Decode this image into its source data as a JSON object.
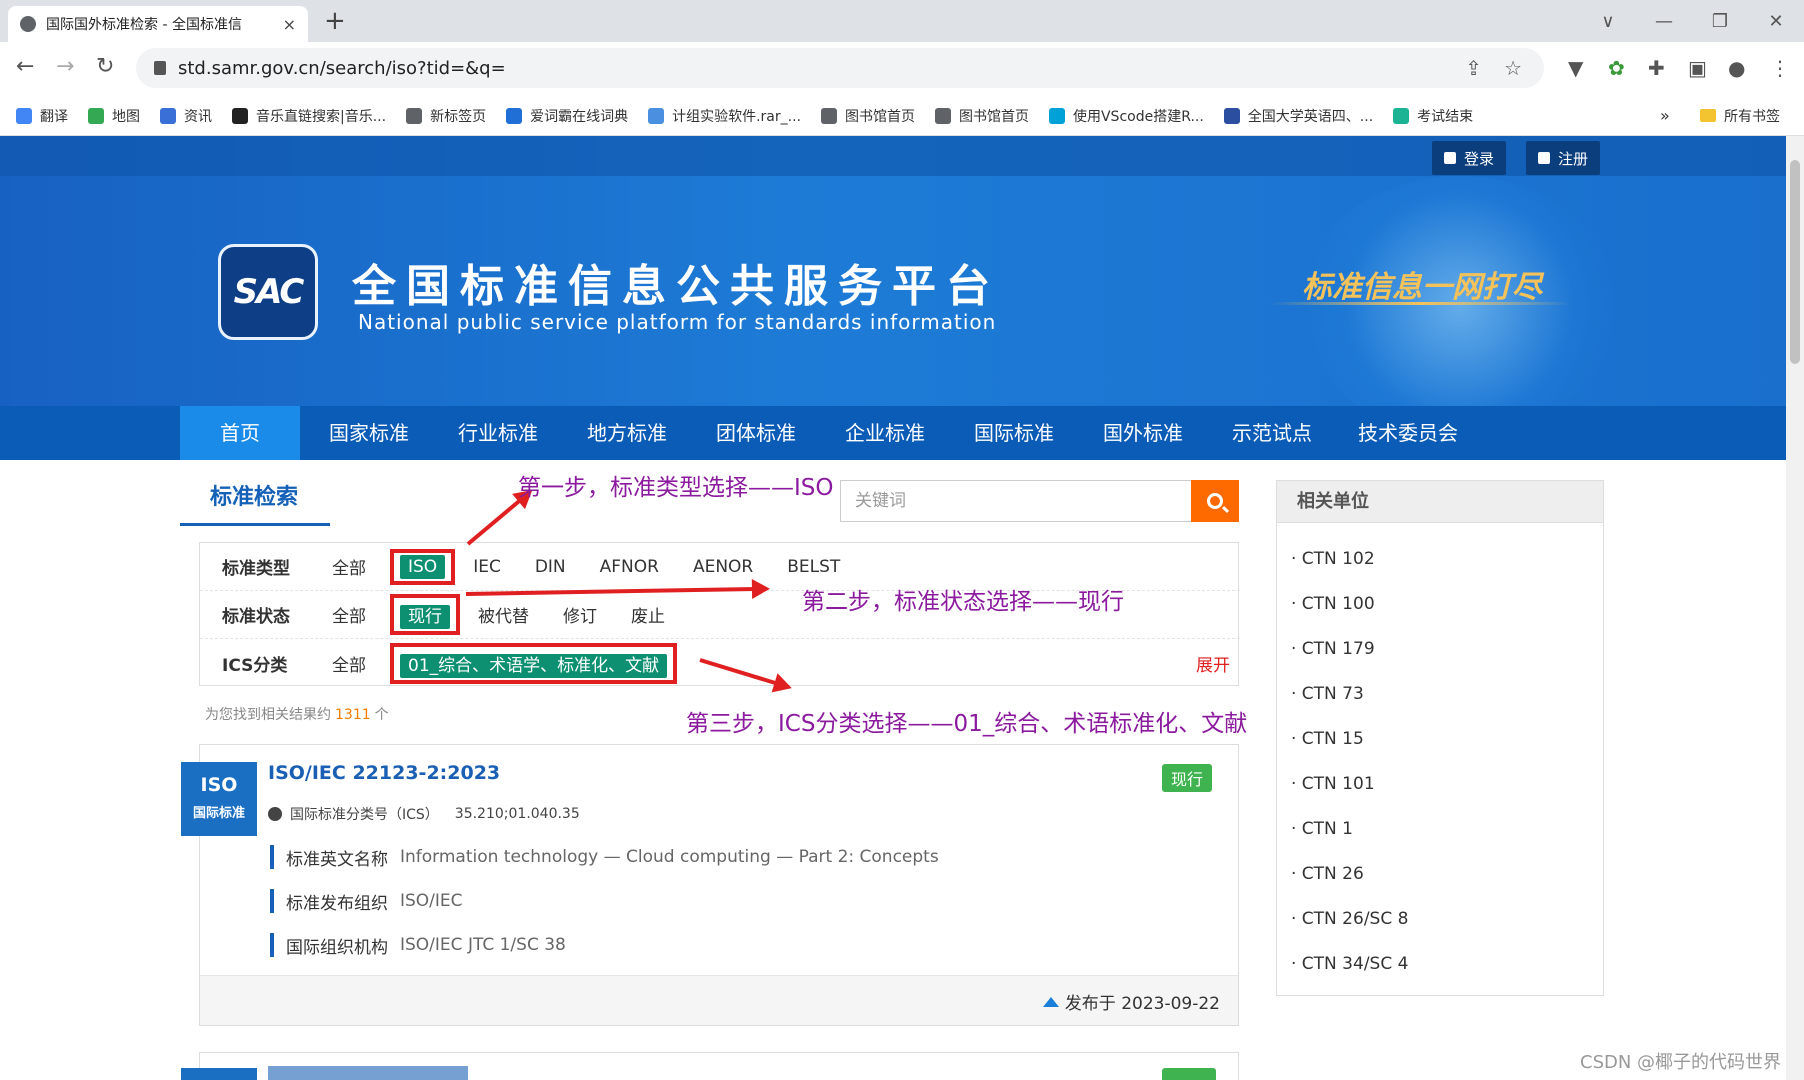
{
  "browser": {
    "tab_title": "国际国外标准检索 - 全国标准信",
    "tab_close": "×",
    "new_tab": "+",
    "url": "std.samr.gov.cn/search/iso?tid=&q=",
    "window_controls": [
      "∨",
      "—",
      "❐",
      "✕"
    ]
  },
  "bookmarks": [
    {
      "label": "翻译",
      "color": "#4285f4"
    },
    {
      "label": "地图",
      "color": "#34a853"
    },
    {
      "label": "资讯",
      "color": "#3b6fd8"
    },
    {
      "label": "音乐直链搜索|音乐...",
      "color": "#222222"
    },
    {
      "label": "新标签页",
      "color": "#5f6368"
    },
    {
      "label": "爱词霸在线词典",
      "color": "#1f6fd6"
    },
    {
      "label": "计组实验软件.rar_...",
      "color": "#4a8fe0"
    },
    {
      "label": "图书馆首页",
      "color": "#5f6368"
    },
    {
      "label": "图书馆首页",
      "color": "#5f6368"
    },
    {
      "label": "使用VScode搭建R...",
      "color": "#00a1d6"
    },
    {
      "label": "全国大学英语四、...",
      "color": "#2b4ea0"
    },
    {
      "label": "考试结束",
      "color": "#1bb394"
    }
  ],
  "bookmarks_more": "»",
  "bookmarks_all": "所有书签",
  "header": {
    "login": "登录",
    "register": "注册",
    "logo_text": "SAC",
    "site_name_cn": "全国标准信息公共服务平台",
    "site_name_en": "National public service platform  for standards information",
    "slogan": "标准信息一网打尽"
  },
  "nav": [
    "首页",
    "国家标准",
    "行业标准",
    "地方标准",
    "团体标准",
    "企业标准",
    "国际标准",
    "国外标准",
    "示范试点",
    "技术委员会"
  ],
  "search": {
    "tab_label": "标准检索",
    "placeholder": "关键词"
  },
  "filters": {
    "type_label": "标准类型",
    "type_options": [
      "全部",
      "ISO",
      "IEC",
      "DIN",
      "AFNOR",
      "AENOR",
      "BELST"
    ],
    "status_label": "标准状态",
    "status_options": [
      "全部",
      "现行",
      "被代替",
      "修订",
      "废止"
    ],
    "ics_label": "ICS分类",
    "ics_all": "全部",
    "ics_selected": "01_综合、术语学、标准化、文献",
    "expand": "展开"
  },
  "results": {
    "prefix": "为您找到相关结果约",
    "count": "1311",
    "suffix": "个"
  },
  "annotations": {
    "step1": "第一步，标准类型选择——ISO",
    "step2": "第二步，标准状态选择——现行",
    "step3": "第三步，ICS分类选择——01_综合、术语标准化、文献"
  },
  "result_card": {
    "badge_line1": "ISO",
    "badge_line2": "国际标准",
    "title": "ISO/IEC 22123-2:2023",
    "status": "现行",
    "ics_label": "国际标准分类号（ICS）",
    "ics_value": "35.210;01.040.35",
    "rows": [
      {
        "label": "标准英文名称",
        "value": "Information technology — Cloud computing — Part 2: Concepts"
      },
      {
        "label": "标准发布组织",
        "value": "ISO/IEC"
      },
      {
        "label": "国际组织机构",
        "value": "ISO/IEC JTC 1/SC 38"
      }
    ],
    "published": "发布于 2023-09-22"
  },
  "sidebar": {
    "title": "相关单位",
    "items": [
      "· CTN 102",
      "· CTN 100",
      "· CTN 179",
      "· CTN 73",
      "· CTN 15",
      "· CTN 101",
      "· CTN 1",
      "· CTN 26",
      "· CTN 26/SC 8",
      "· CTN 34/SC 4"
    ]
  },
  "watermark": "CSDN @椰子的代码世界",
  "colors": {
    "banner": "#1d7bd6",
    "nav": "#0b5cb7",
    "nav_active": "#1a8be8",
    "chip": "#0d8f71",
    "highlight_box": "#e02020",
    "annotation_text": "#8b1a9e",
    "status_green": "#3fb34f",
    "search_button": "#ff6a00"
  }
}
